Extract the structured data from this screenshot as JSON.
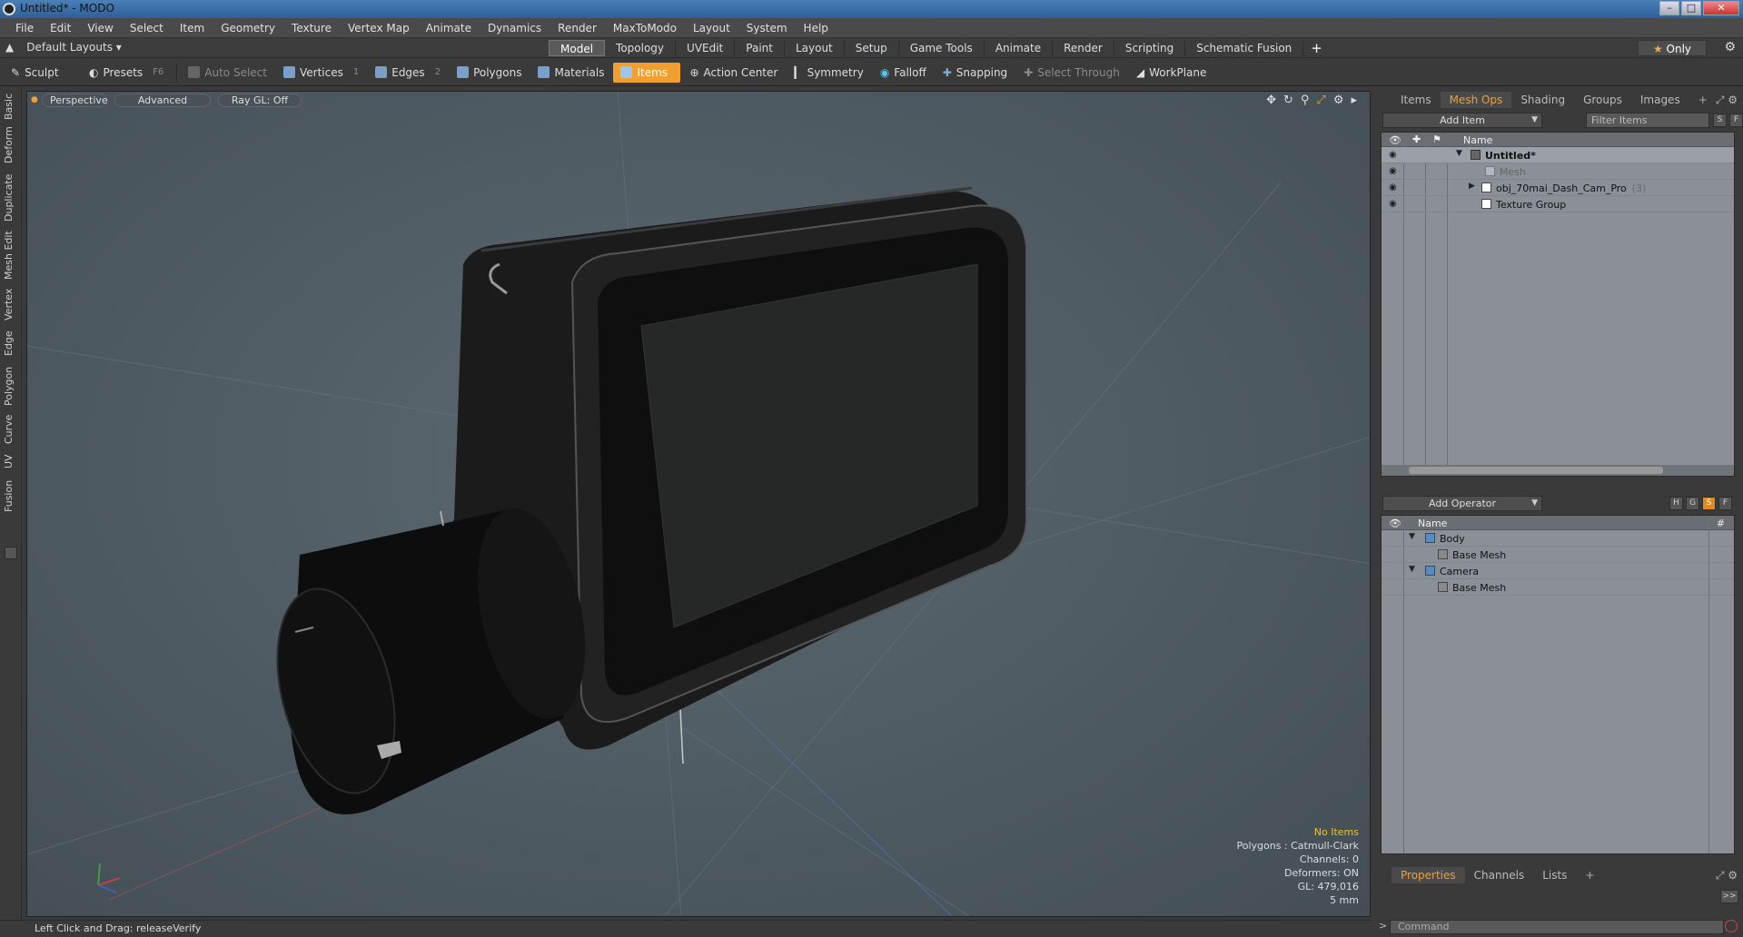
{
  "window": {
    "title": "Untitled* - MODO"
  },
  "menu": [
    "File",
    "Edit",
    "View",
    "Select",
    "Item",
    "Geometry",
    "Texture",
    "Vertex Map",
    "Animate",
    "Dynamics",
    "Render",
    "MaxToModo",
    "Layout",
    "System",
    "Help"
  ],
  "layouts": {
    "label": "Default Layouts ▾"
  },
  "mode_tabs": [
    "Model",
    "Topology",
    "UVEdit",
    "Paint",
    "Layout",
    "Setup",
    "Game Tools",
    "Animate",
    "Render",
    "Scripting",
    "Schematic Fusion"
  ],
  "mode_active": "Model",
  "only_label": "Only",
  "toolbar": {
    "sculpt": "Sculpt",
    "presets": "Presets",
    "presets_key": "F6",
    "auto_select": "Auto Select",
    "vertices": "Vertices",
    "vertices_key": "1",
    "edges": "Edges",
    "edges_key": "2",
    "polygons": "Polygons",
    "materials": "Materials",
    "items": "Items",
    "action_center": "Action Center",
    "symmetry": "Symmetry",
    "falloff": "Falloff",
    "snapping": "Snapping",
    "select_through": "Select Through",
    "workplane": "WorkPlane"
  },
  "left_tabs": [
    "Basic",
    "Deform",
    "Duplicate",
    "Mesh Edit",
    "Vertex",
    "Edge",
    "Polygon",
    "Curve",
    "UV",
    "Fusion"
  ],
  "viewport": {
    "view_mode": "Perspective",
    "shading": "Advanced",
    "raygl": "Ray GL: Off",
    "info": {
      "items": "No Items",
      "polygons": "Polygons : Catmull-Clark",
      "channels": "Channels: 0",
      "deformers": "Deformers: ON",
      "gl": "GL: 479,016",
      "scale": "5 mm"
    }
  },
  "status": "Left Click and Drag:  releaseVerify",
  "items_panel": {
    "tabs": [
      "Items",
      "Mesh Ops",
      "Shading",
      "Groups",
      "Images"
    ],
    "active_tab": "Mesh Ops",
    "add_item": "Add Item",
    "filter_placeholder": "Filter Items",
    "btn_s": "S",
    "btn_f": "F",
    "column_name": "Name",
    "rows": [
      {
        "label": "Untitled*",
        "count": ""
      },
      {
        "label": "Mesh",
        "count": ""
      },
      {
        "label": "obj_70mai_Dash_Cam_Pro",
        "count": "(3)"
      },
      {
        "label": "Texture Group",
        "count": ""
      }
    ]
  },
  "ops_panel": {
    "add_operator": "Add Operator",
    "btn_h": "H",
    "btn_g": "G",
    "btn_s": "S",
    "btn_f": "F",
    "column_name": "Name",
    "column_hash": "#",
    "rows": [
      {
        "label": "Body"
      },
      {
        "label": "Base Mesh"
      },
      {
        "label": "Camera"
      },
      {
        "label": "Base Mesh"
      }
    ]
  },
  "properties_panel": {
    "tabs": [
      "Properties",
      "Channels",
      "Lists"
    ],
    "active_tab": "Properties",
    "expand": ">>"
  },
  "command": {
    "placeholder": "Command"
  },
  "colors": {
    "accent": "#f0a030",
    "viewport_bg": "#56636b"
  }
}
